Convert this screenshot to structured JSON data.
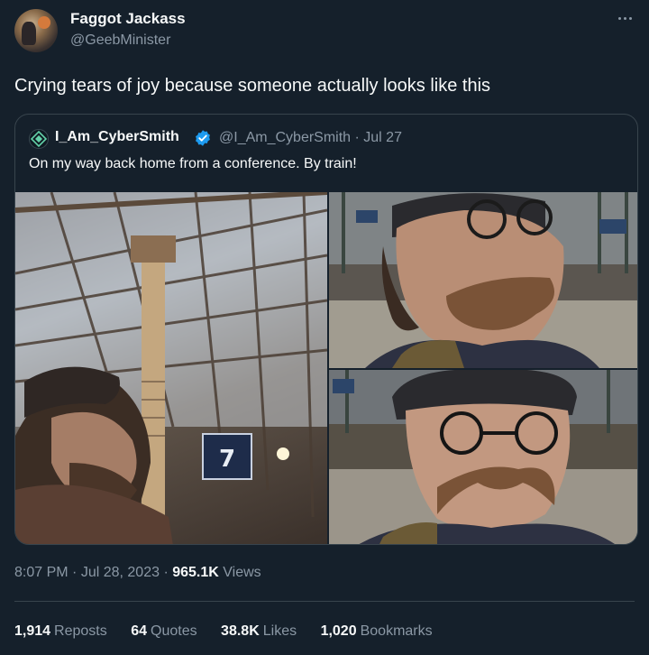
{
  "author": {
    "display_name": "Faggot Jackass",
    "handle": "@GeebMinister"
  },
  "tweet": {
    "text": "Crying tears of joy because someone actually looks like this"
  },
  "quoted": {
    "name": "I_Am_CyberSmith",
    "handle_date": "@I_Am_CyberSmith · Jul 27",
    "text": "On my way back home from a conference. By train!",
    "platform_number": "7"
  },
  "meta": {
    "time": "8:07 PM",
    "date": "Jul 28, 2023",
    "views_count": "965.1K",
    "views_label": "Views"
  },
  "stats": {
    "reposts_count": "1,914",
    "reposts_label": "Reposts",
    "quotes_count": "64",
    "quotes_label": "Quotes",
    "likes_count": "38.8K",
    "likes_label": "Likes",
    "bookmarks_count": "1,020",
    "bookmarks_label": "Bookmarks"
  },
  "colors": {
    "background": "#15202b",
    "text": "#f7f9f9",
    "secondary": "#8b98a5",
    "border": "#38444d",
    "verified": "#1d9bf0"
  },
  "icons": [
    "more-icon",
    "verified-icon",
    "diamond-avatar-icon"
  ]
}
